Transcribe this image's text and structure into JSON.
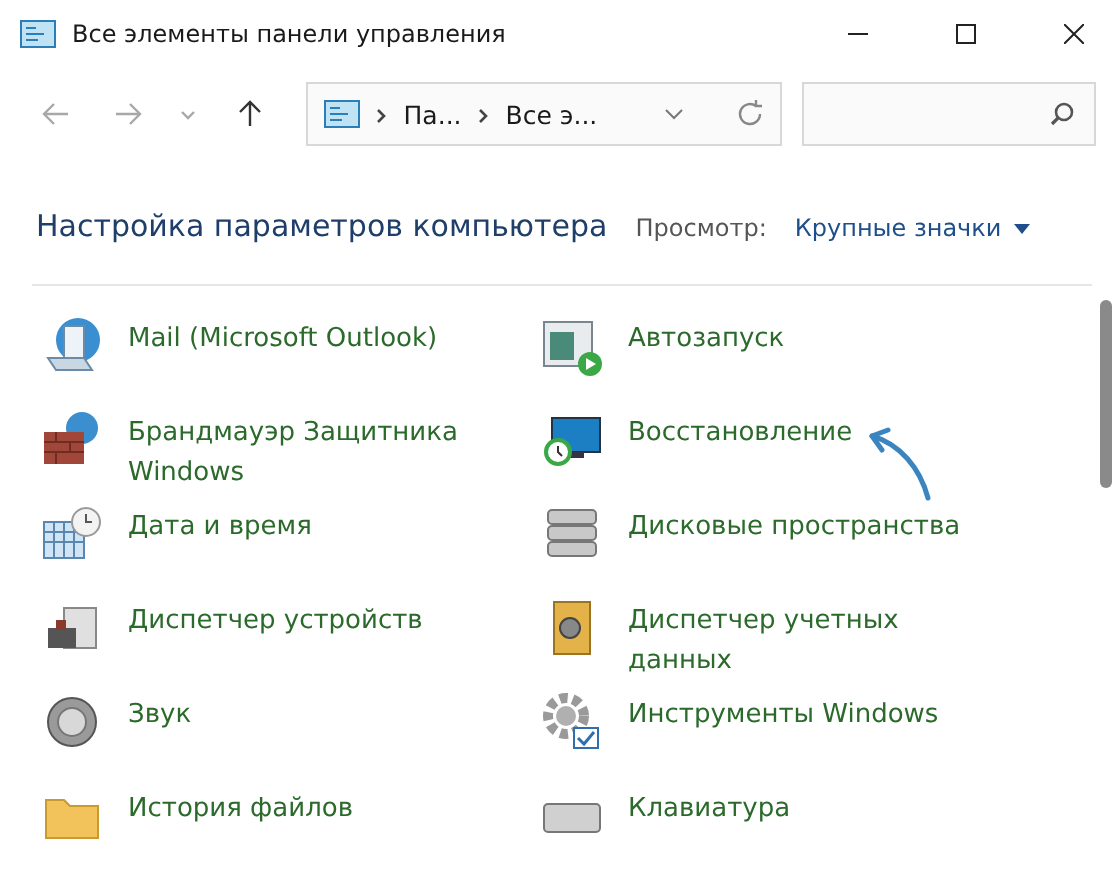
{
  "window": {
    "title": "Все элементы панели управления"
  },
  "navigation": [
    {
      "kind": "back",
      "disabled": true
    },
    {
      "kind": "forward",
      "disabled": true
    },
    {
      "kind": "recent",
      "disabled": true
    },
    {
      "kind": "up",
      "disabled": false
    }
  ],
  "address_bar": {
    "crumbs": [
      "Па...",
      "Все э..."
    ]
  },
  "header": {
    "title": "Настройка параметров компьютера",
    "view_label": "Просмотр:",
    "view_value": "Крупные значки"
  },
  "items": [
    {
      "label": "Mail (Microsoft Outlook)"
    },
    {
      "label": "Автозапуск"
    },
    {
      "label": "Брандмауэр Защитника Windows"
    },
    {
      "label": "Восстановление"
    },
    {
      "label": "Дата и время"
    },
    {
      "label": "Дисковые пространства"
    },
    {
      "label": "Диспетчер устройств"
    },
    {
      "label": "Диспетчер учетных данных"
    },
    {
      "label": "Звук"
    },
    {
      "label": "Инструменты Windows"
    },
    {
      "label": "История файлов"
    },
    {
      "label": "Клавиатура"
    }
  ]
}
